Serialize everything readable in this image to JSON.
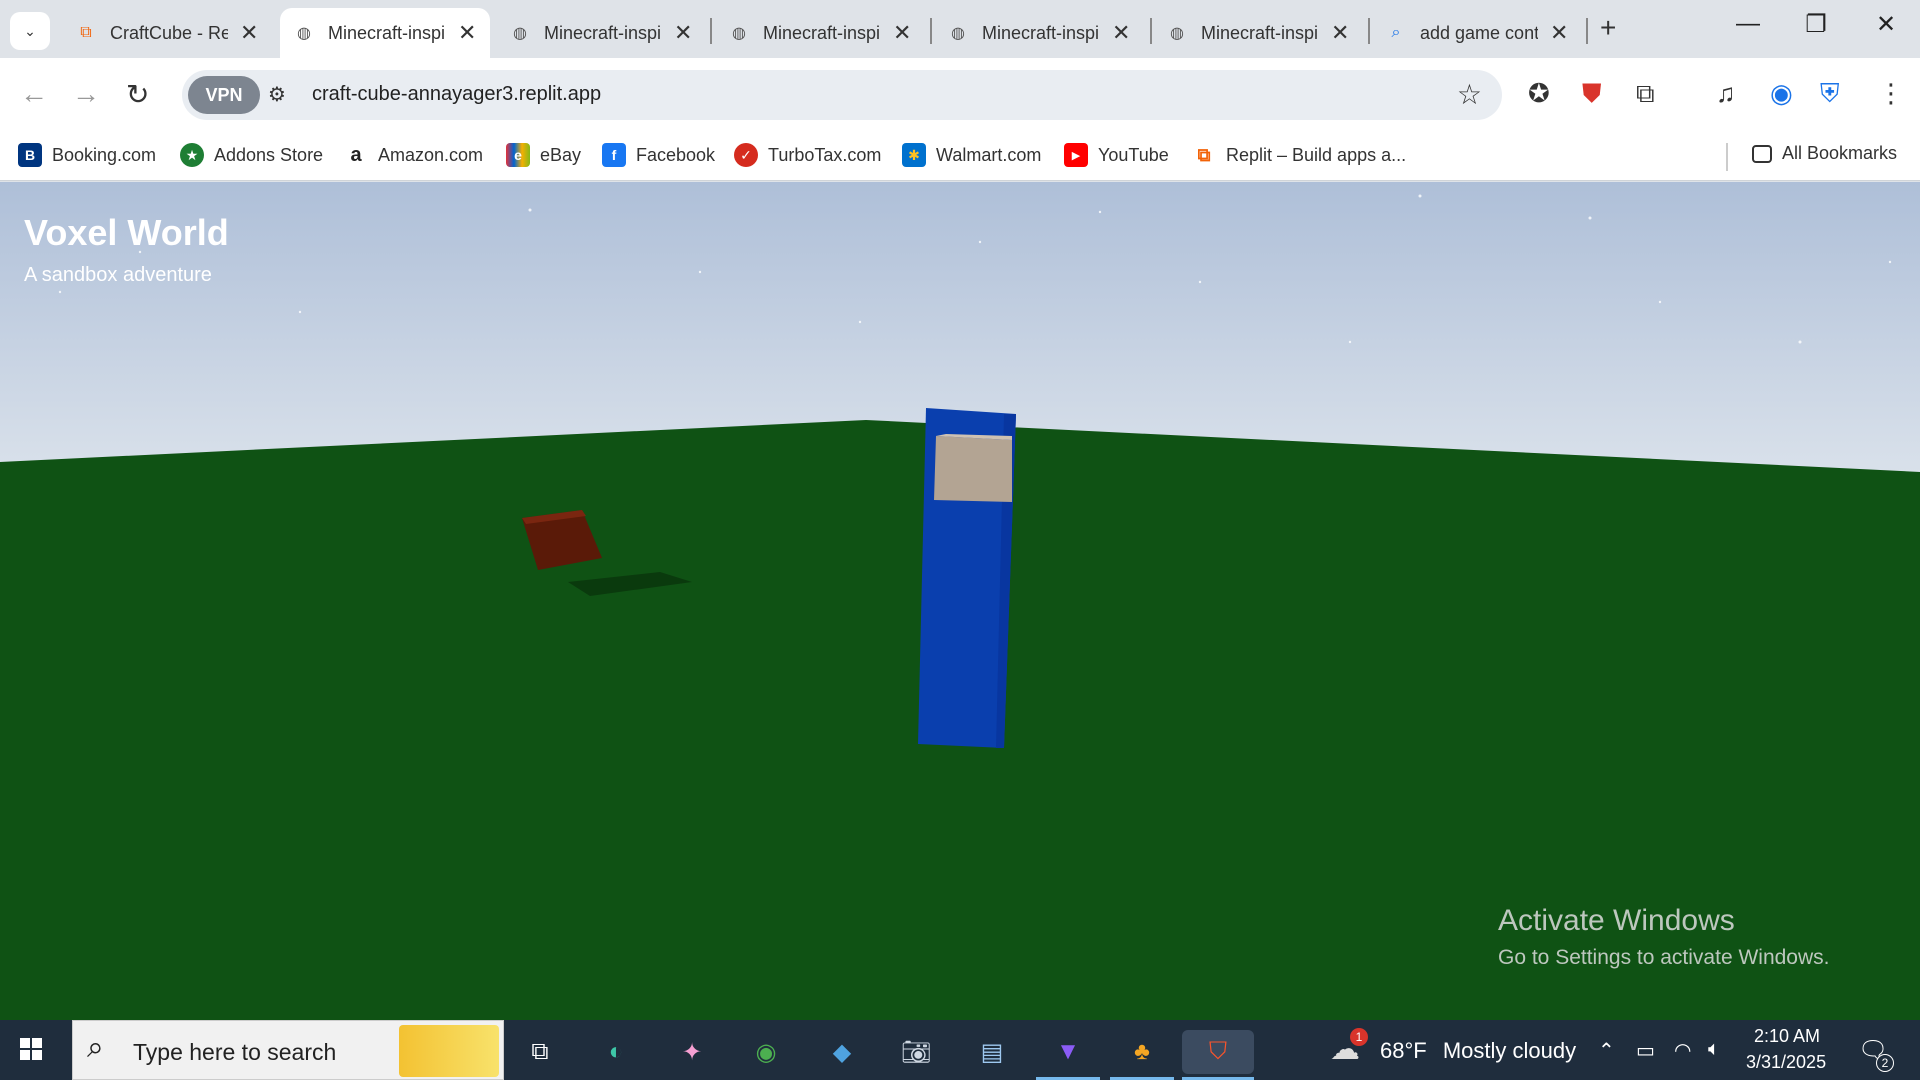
{
  "browser": {
    "tabs": [
      {
        "title": "CraftCube - Replit",
        "favicon": "replit-icon",
        "active": false
      },
      {
        "title": "Minecraft-inspired",
        "favicon": "globe-icon",
        "active": true
      },
      {
        "title": "Minecraft-inspired",
        "favicon": "globe-icon",
        "active": false
      },
      {
        "title": "Minecraft-inspired",
        "favicon": "globe-icon",
        "active": false
      },
      {
        "title": "Minecraft-inspired",
        "favicon": "globe-icon",
        "active": false
      },
      {
        "title": "Minecraft-inspired",
        "favicon": "globe-icon",
        "active": false
      },
      {
        "title": "add game controls",
        "favicon": "search-icon",
        "active": false
      }
    ],
    "vpn_label": "VPN",
    "url": "craft-cube-annayager3.replit.app",
    "bookmarks": [
      {
        "label": "Booking.com",
        "icon": "booking-icon",
        "color": "#003580",
        "glyph": "B"
      },
      {
        "label": "Addons Store",
        "icon": "addons-store-icon",
        "color": "#1e7e34",
        "glyph": "★"
      },
      {
        "label": "Amazon.com",
        "icon": "amazon-icon",
        "color": "#222222",
        "glyph": "a"
      },
      {
        "label": "eBay",
        "icon": "ebay-icon",
        "color": "#e53238",
        "glyph": "e"
      },
      {
        "label": "Facebook",
        "icon": "facebook-icon",
        "color": "#1877f2",
        "glyph": "f"
      },
      {
        "label": "TurboTax.com",
        "icon": "turbotax-icon",
        "color": "#d52b1e",
        "glyph": "✓"
      },
      {
        "label": "Walmart.com",
        "icon": "walmart-icon",
        "color": "#0071ce",
        "glyph": "✱"
      },
      {
        "label": "YouTube",
        "icon": "youtube-icon",
        "color": "#ff0000",
        "glyph": "▶"
      },
      {
        "label": "Replit – Build apps a...",
        "icon": "replit-icon",
        "color": "#f26207",
        "glyph": "⧉"
      }
    ],
    "all_bookmarks_label": "All Bookmarks"
  },
  "game": {
    "title": "Voxel World",
    "subtitle": "A sandbox adventure",
    "colors": {
      "ground": "#0f5214",
      "player_body": "#0a3fae",
      "player_head": "#b3a493",
      "block": "#5a1a08"
    }
  },
  "watermark": {
    "line1": "Activate Windows",
    "line2": "Go to Settings to activate Windows."
  },
  "taskbar": {
    "search_placeholder": "Type here to search",
    "weather_temp": "68°F",
    "weather_text": "Mostly cloudy",
    "weather_badge": "1",
    "time": "2:10 AM",
    "date": "3/31/2025",
    "notification_count": "2"
  }
}
